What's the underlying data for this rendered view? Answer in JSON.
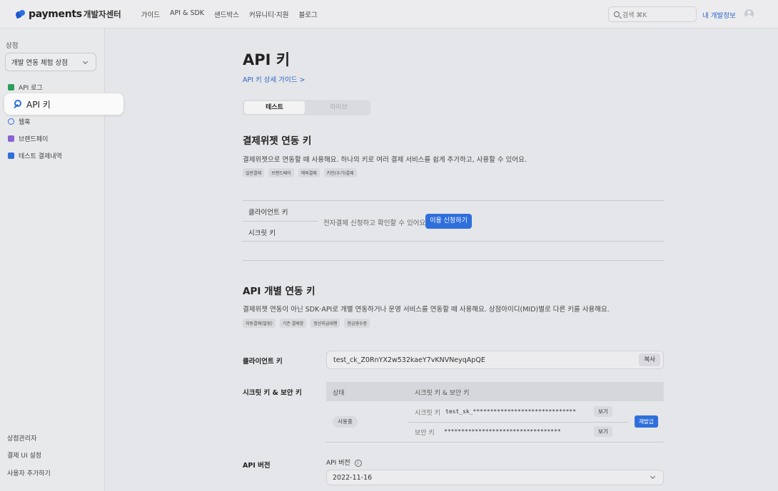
{
  "header": {
    "brand": "payments",
    "brand_sub": "개발자센터",
    "nav": [
      "가이드",
      "API & SDK",
      "샌드박스",
      "커뮤니티·지원",
      "블로그"
    ],
    "search_placeholder": "검색 ⌘K",
    "my_info": "내 개발정보"
  },
  "sidebar": {
    "store_label": "상점",
    "store_select": "개발 연동 체험 상점",
    "items": [
      {
        "label": "API 로그",
        "icon": "log-icon",
        "color": "#2e9e5b"
      },
      {
        "label": "API 키",
        "icon": "key-icon",
        "color": "#2f6fdc"
      },
      {
        "label": "웹훅",
        "icon": "webhook-icon",
        "color": "#2f6fdc"
      },
      {
        "label": "브랜드페이",
        "icon": "brandpay-icon",
        "color": "#8a63d2"
      },
      {
        "label": "테스트 결제내역",
        "icon": "receipt-icon",
        "color": "#2f6fdc"
      }
    ],
    "bottom": [
      "상점관리자",
      "결제 UI 설정",
      "사용자 추가하기"
    ]
  },
  "main": {
    "title": "API 키",
    "guide_link": "API 키 상세 가이드 >",
    "tabs": [
      "테스트",
      "라이브"
    ],
    "widget": {
      "heading": "결제위젯 연동 키",
      "description": "결제위젯으로 연동할 때 사용해요. 하나의 키로 여러 결제 서비스를 쉽게 추가하고, 사용할 수 있어요.",
      "chips": [
        "일반결제",
        "브랜드페이",
        "해외결제",
        "키인(수기)결제"
      ],
      "client_key_label": "클라이언트 키",
      "secret_key_label": "시크릿 키",
      "notice": "전자결제 신청하고 확인할 수 있어요.",
      "apply_button": "이용 신청하기"
    },
    "individual": {
      "heading": "API 개별 연동 키",
      "description": "결제위젯 연동이 아닌 SDK·API로 개별 연동하거나 운영 서비스를 연동할 때 사용해요. 상점아이디(MID)별로 다른 키를 사용해요.",
      "chips": [
        "자동결제(빌링)",
        "기존 결제창",
        "정산지급대행",
        "현금영수증"
      ],
      "client_key_label": "클라이언트 키",
      "client_key_value": "test_ck_Z0RnYX2w532kaeY7vKNVNeyqApQE",
      "copy_button": "복사",
      "secret_section_label": "시크릿 키 & 보안 키",
      "table_headers": [
        "상태",
        "시크릿 키 & 보안 키"
      ],
      "status": "사용중",
      "secret_key_label": "시크릿 키",
      "secret_key_value": "test_sk_******************************",
      "security_key_label": "보안 키",
      "security_key_value": "**********************************",
      "view_button": "보기",
      "reissue_button": "재발급",
      "version_label": "API 버전",
      "version_field_label": "API 버전",
      "version_value": "2022-11-16"
    }
  }
}
